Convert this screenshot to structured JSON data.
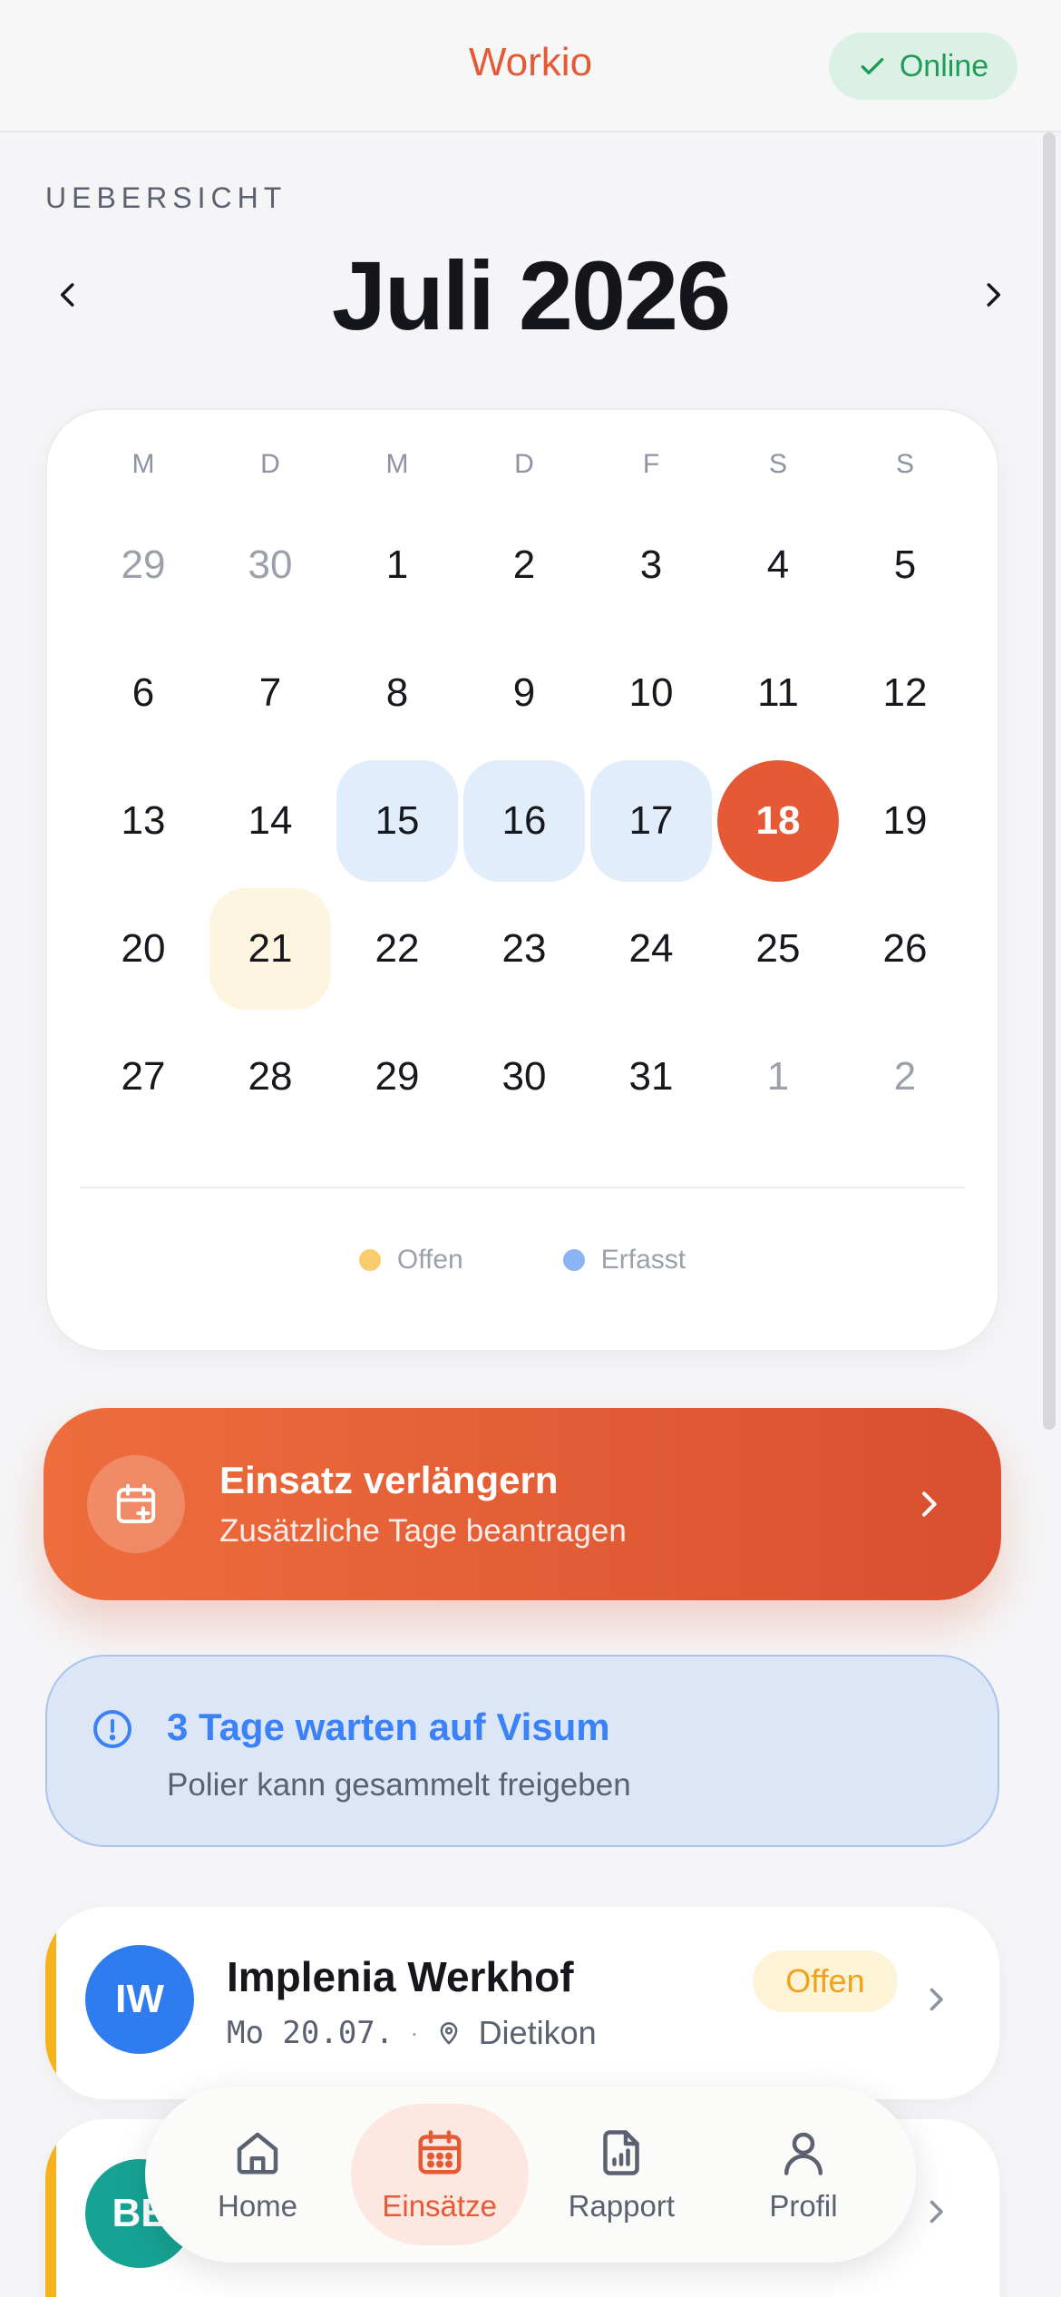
{
  "app": {
    "title": "Workio",
    "status": "Online"
  },
  "overview": {
    "section_label": "UEBERSICHT",
    "month_title": "Juli 2026"
  },
  "calendar": {
    "weekdays": [
      "M",
      "D",
      "M",
      "D",
      "F",
      "S",
      "S"
    ],
    "days": [
      {
        "label": "29",
        "state": "muted"
      },
      {
        "label": "30",
        "state": "muted"
      },
      {
        "label": "1",
        "state": ""
      },
      {
        "label": "2",
        "state": ""
      },
      {
        "label": "3",
        "state": ""
      },
      {
        "label": "4",
        "state": ""
      },
      {
        "label": "5",
        "state": ""
      },
      {
        "label": "6",
        "state": ""
      },
      {
        "label": "7",
        "state": ""
      },
      {
        "label": "8",
        "state": ""
      },
      {
        "label": "9",
        "state": ""
      },
      {
        "label": "10",
        "state": ""
      },
      {
        "label": "11",
        "state": ""
      },
      {
        "label": "12",
        "state": ""
      },
      {
        "label": "13",
        "state": ""
      },
      {
        "label": "14",
        "state": ""
      },
      {
        "label": "15",
        "state": "erfasst"
      },
      {
        "label": "16",
        "state": "erfasst"
      },
      {
        "label": "17",
        "state": "erfasst"
      },
      {
        "label": "18",
        "state": "today"
      },
      {
        "label": "19",
        "state": ""
      },
      {
        "label": "20",
        "state": ""
      },
      {
        "label": "21",
        "state": "offen"
      },
      {
        "label": "22",
        "state": ""
      },
      {
        "label": "23",
        "state": ""
      },
      {
        "label": "24",
        "state": ""
      },
      {
        "label": "25",
        "state": ""
      },
      {
        "label": "26",
        "state": ""
      },
      {
        "label": "27",
        "state": ""
      },
      {
        "label": "28",
        "state": ""
      },
      {
        "label": "29",
        "state": ""
      },
      {
        "label": "30",
        "state": ""
      },
      {
        "label": "31",
        "state": ""
      },
      {
        "label": "1",
        "state": "muted"
      },
      {
        "label": "2",
        "state": "muted"
      }
    ],
    "legend": [
      {
        "label": "Offen",
        "color": "#f9cc6e"
      },
      {
        "label": "Erfasst",
        "color": "#8ab4f4"
      }
    ]
  },
  "extend_card": {
    "title": "Einsatz verlängern",
    "subtitle": "Zusätzliche Tage beantragen"
  },
  "info_card": {
    "title": "3 Tage warten auf Visum",
    "subtitle": "Polier kann gesammelt freigeben"
  },
  "jobs": [
    {
      "initials": "IW",
      "name": "Implenia Werkhof",
      "date": "Mo 20.07.",
      "separator": "·",
      "location": "Dietikon",
      "badge": "Offen",
      "avatar_color": "#2f7cf0"
    },
    {
      "initials": "BE",
      "avatar_color": "#16a394"
    }
  ],
  "nav": [
    {
      "label": "Home",
      "icon": "home-icon",
      "active": false
    },
    {
      "label": "Einsätze",
      "icon": "calendar-icon",
      "active": true
    },
    {
      "label": "Rapport",
      "icon": "report-icon",
      "active": false
    },
    {
      "label": "Profil",
      "icon": "profile-icon",
      "active": false
    }
  ],
  "colors": {
    "accent": "#e55a35",
    "online": "#1f9d57",
    "info": "#3b82f6",
    "offen": "#f0a21a"
  }
}
